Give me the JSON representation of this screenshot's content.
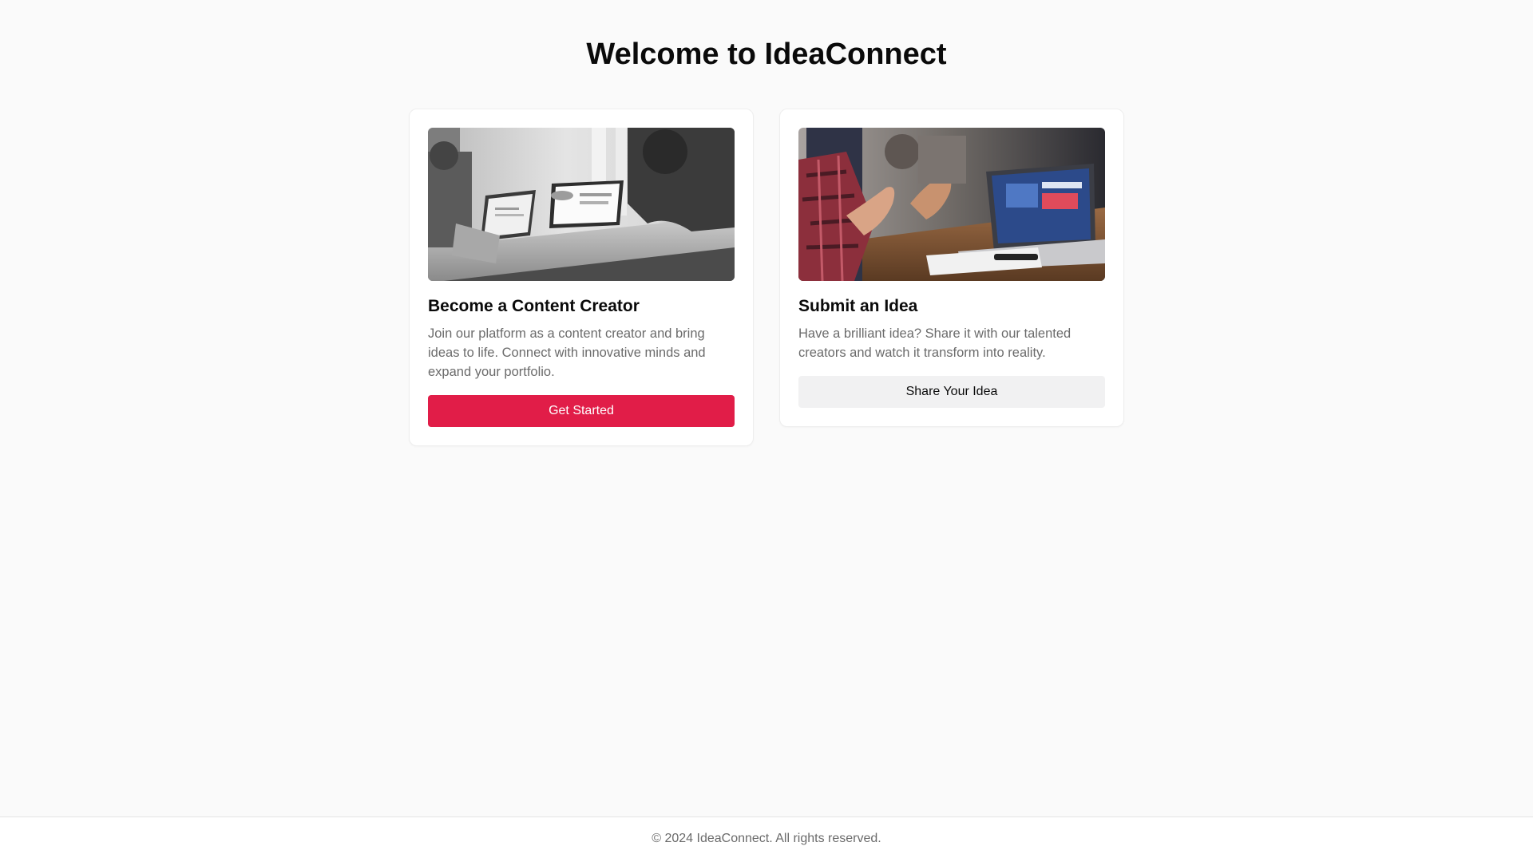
{
  "header": {
    "title": "Welcome to IdeaConnect"
  },
  "cards": [
    {
      "image_alt": "Two people working on laptops at a desk, black and white photo",
      "title": "Become a Content Creator",
      "description": "Join our platform as a content creator and bring ideas to life. Connect with innovative minds and expand your portfolio.",
      "button_label": "Get Started"
    },
    {
      "image_alt": "People gesturing during a meeting around a laptop",
      "title": "Submit an Idea",
      "description": "Have a brilliant idea? Share it with our talented creators and watch it transform into reality.",
      "button_label": "Share Your Idea"
    }
  ],
  "footer": {
    "copyright": "© 2024 IdeaConnect. All rights reserved."
  },
  "colors": {
    "accent": "#e11d48",
    "background": "#fafafa",
    "secondary_button": "#f1f1f2",
    "muted_text": "#6b6b6b"
  }
}
